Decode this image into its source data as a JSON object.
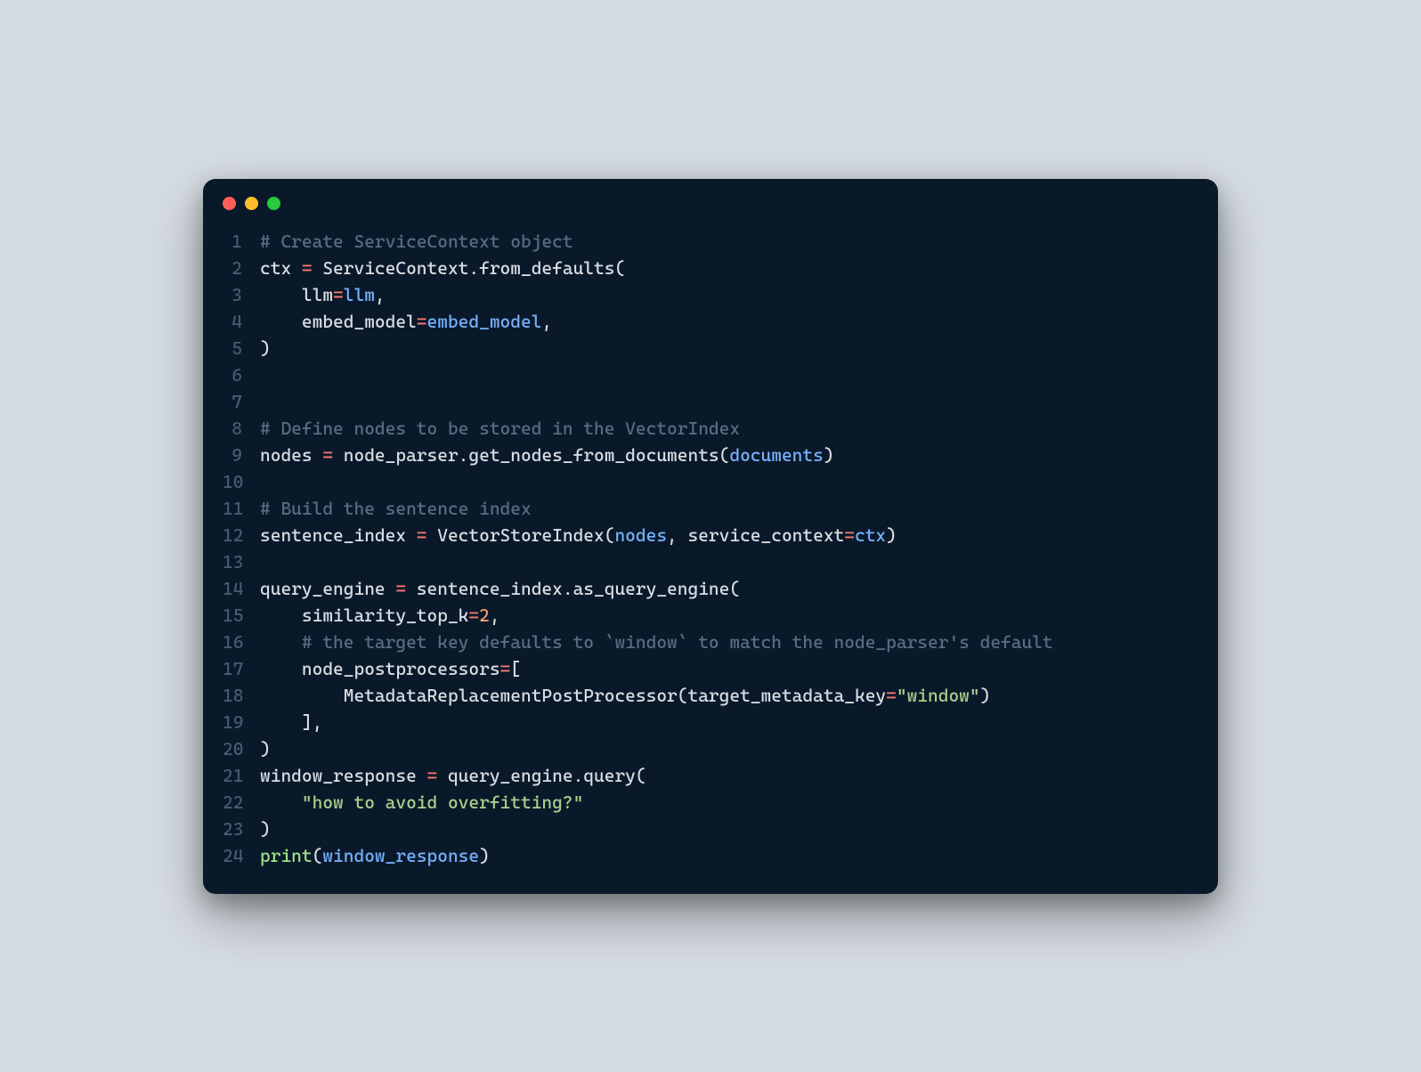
{
  "window": {
    "traffic_lights": [
      "close",
      "minimize",
      "zoom"
    ]
  },
  "code": {
    "lines": [
      {
        "n": 1,
        "tokens": [
          [
            "comment",
            "# Create ServiceContext object"
          ]
        ]
      },
      {
        "n": 2,
        "tokens": [
          [
            "def",
            "ctx "
          ],
          [
            "op",
            "="
          ],
          [
            "def",
            " ServiceContext"
          ],
          [
            "punct",
            "."
          ],
          [
            "func",
            "from_defaults"
          ],
          [
            "punct",
            "("
          ]
        ]
      },
      {
        "n": 3,
        "tokens": [
          [
            "def",
            "    llm"
          ],
          [
            "op",
            "="
          ],
          [
            "attr",
            "llm"
          ],
          [
            "punct",
            ","
          ]
        ]
      },
      {
        "n": 4,
        "tokens": [
          [
            "def",
            "    embed_model"
          ],
          [
            "op",
            "="
          ],
          [
            "attr",
            "embed_model"
          ],
          [
            "punct",
            ","
          ]
        ]
      },
      {
        "n": 5,
        "tokens": [
          [
            "punct",
            ")"
          ]
        ]
      },
      {
        "n": 6,
        "tokens": [
          [
            "def",
            ""
          ]
        ]
      },
      {
        "n": 7,
        "tokens": [
          [
            "def",
            ""
          ]
        ]
      },
      {
        "n": 8,
        "tokens": [
          [
            "comment",
            "# Define nodes to be stored in the VectorIndex"
          ]
        ]
      },
      {
        "n": 9,
        "tokens": [
          [
            "def",
            "nodes "
          ],
          [
            "op",
            "="
          ],
          [
            "def",
            " node_parser"
          ],
          [
            "punct",
            "."
          ],
          [
            "func",
            "get_nodes_from_documents"
          ],
          [
            "punct",
            "("
          ],
          [
            "attr",
            "documents"
          ],
          [
            "punct",
            ")"
          ]
        ]
      },
      {
        "n": 10,
        "tokens": [
          [
            "def",
            ""
          ]
        ]
      },
      {
        "n": 11,
        "tokens": [
          [
            "comment",
            "# Build the sentence index"
          ]
        ]
      },
      {
        "n": 12,
        "tokens": [
          [
            "def",
            "sentence_index "
          ],
          [
            "op",
            "="
          ],
          [
            "def",
            " VectorStoreIndex"
          ],
          [
            "punct",
            "("
          ],
          [
            "attr",
            "nodes"
          ],
          [
            "punct",
            ", "
          ],
          [
            "def",
            "service_context"
          ],
          [
            "op",
            "="
          ],
          [
            "attr",
            "ctx"
          ],
          [
            "punct",
            ")"
          ]
        ]
      },
      {
        "n": 13,
        "tokens": [
          [
            "def",
            ""
          ]
        ]
      },
      {
        "n": 14,
        "tokens": [
          [
            "def",
            "query_engine "
          ],
          [
            "op",
            "="
          ],
          [
            "def",
            " sentence_index"
          ],
          [
            "punct",
            "."
          ],
          [
            "func",
            "as_query_engine"
          ],
          [
            "punct",
            "("
          ]
        ]
      },
      {
        "n": 15,
        "tokens": [
          [
            "def",
            "    similarity_top_k"
          ],
          [
            "op",
            "="
          ],
          [
            "num",
            "2"
          ],
          [
            "punct",
            ","
          ]
        ]
      },
      {
        "n": 16,
        "tokens": [
          [
            "def",
            "    "
          ],
          [
            "comment",
            "# the target key defaults to `window` to match the node_parser's default"
          ]
        ]
      },
      {
        "n": 17,
        "tokens": [
          [
            "def",
            "    node_postprocessors"
          ],
          [
            "op",
            "="
          ],
          [
            "punct",
            "["
          ]
        ]
      },
      {
        "n": 18,
        "tokens": [
          [
            "def",
            "        MetadataReplacementPostProcessor"
          ],
          [
            "punct",
            "("
          ],
          [
            "def",
            "target_metadata_key"
          ],
          [
            "op",
            "="
          ],
          [
            "str",
            "\"window\""
          ],
          [
            "punct",
            ")"
          ]
        ]
      },
      {
        "n": 19,
        "tokens": [
          [
            "def",
            "    "
          ],
          [
            "punct",
            "],"
          ]
        ]
      },
      {
        "n": 20,
        "tokens": [
          [
            "punct",
            ")"
          ]
        ]
      },
      {
        "n": 21,
        "tokens": [
          [
            "def",
            "window_response "
          ],
          [
            "op",
            "="
          ],
          [
            "def",
            " query_engine"
          ],
          [
            "punct",
            "."
          ],
          [
            "func",
            "query"
          ],
          [
            "punct",
            "("
          ]
        ]
      },
      {
        "n": 22,
        "tokens": [
          [
            "def",
            "    "
          ],
          [
            "str",
            "\"how to avoid overfitting?\""
          ]
        ]
      },
      {
        "n": 23,
        "tokens": [
          [
            "punct",
            ")"
          ]
        ]
      },
      {
        "n": 24,
        "tokens": [
          [
            "builtin",
            "print"
          ],
          [
            "punct",
            "("
          ],
          [
            "attr",
            "window_response"
          ],
          [
            "punct",
            ")"
          ]
        ]
      }
    ]
  }
}
